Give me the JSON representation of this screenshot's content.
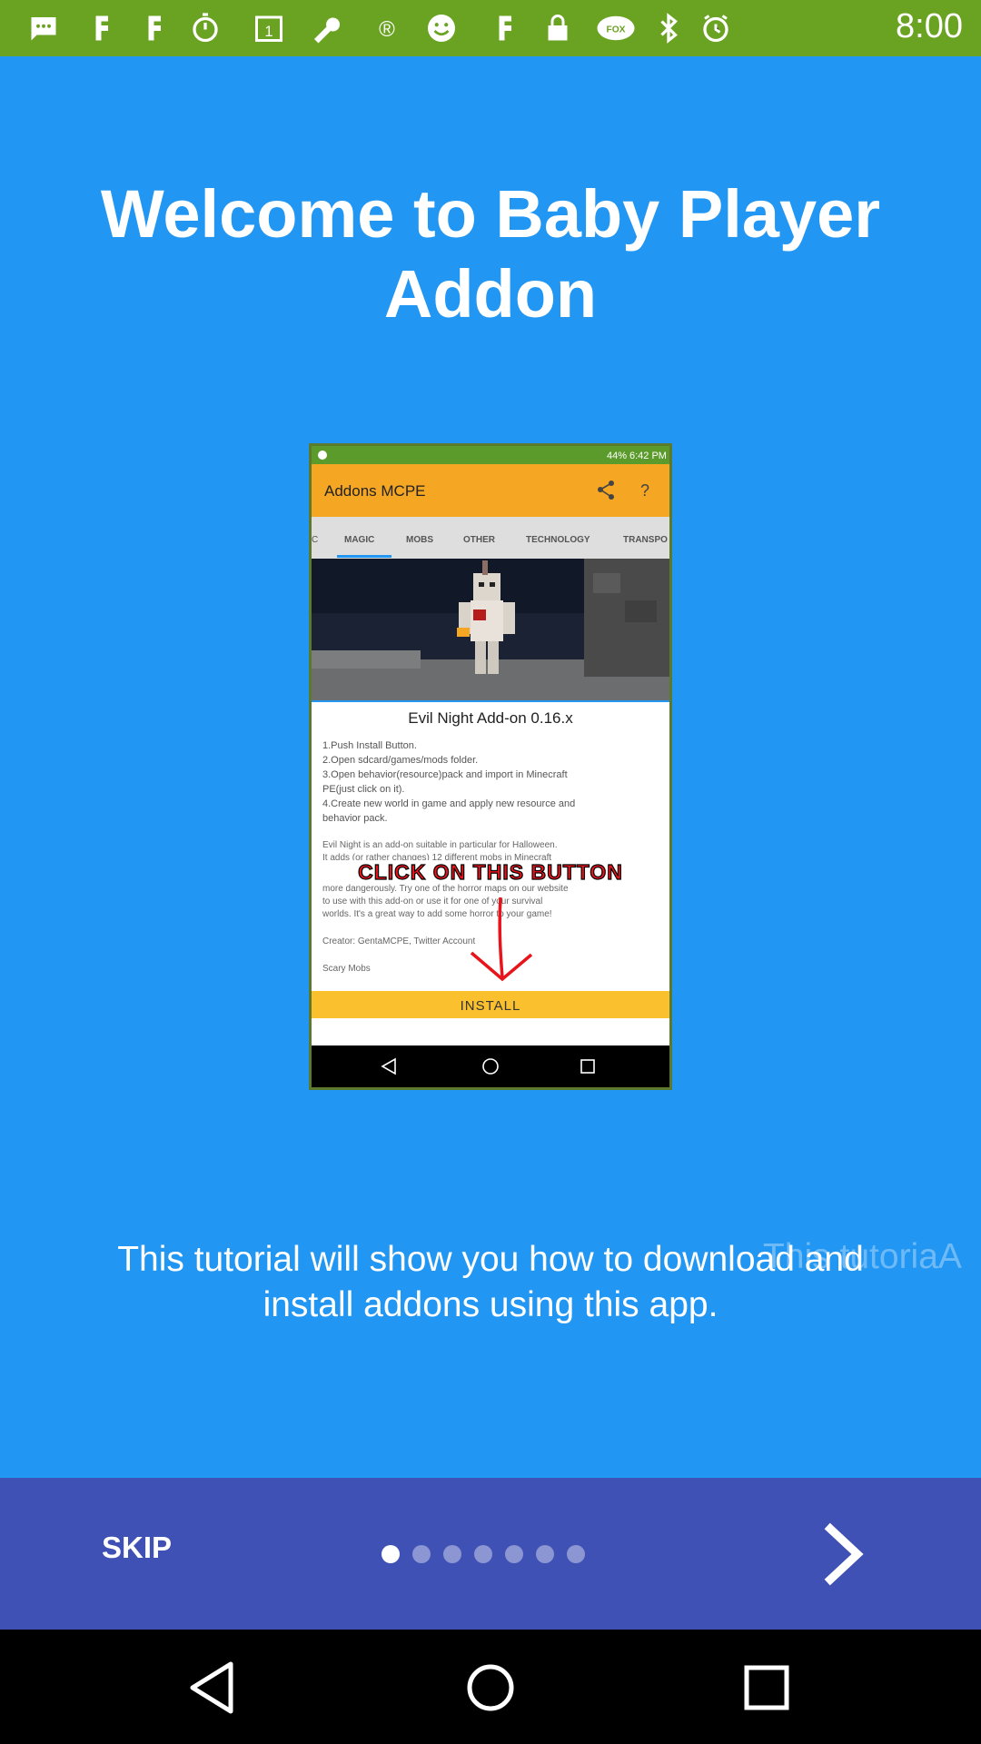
{
  "status_bar": {
    "time": "8:00",
    "icons": [
      "message-icon",
      "facebook-icon",
      "facebook-icon",
      "timer-icon",
      "calendar-icon",
      "wrench-icon",
      "app-icon",
      "smiley-icon",
      "facebook-icon",
      "lock-icon",
      "fox-icon",
      "bluetooth-icon",
      "alarm-icon"
    ]
  },
  "welcome": {
    "title": "Welcome to Baby Player Addon",
    "caption": "This tutorial will show you how to download and install addons using this app.",
    "ghost_text": "This tutoriaA"
  },
  "preview": {
    "status_percent": "44%",
    "status_time": "6:42 PM",
    "toolbar_title": "Addons MCPE",
    "tabs": [
      "C",
      "MAGIC",
      "MOBS",
      "OTHER",
      "TECHNOLOGY",
      "TRANSPO"
    ],
    "active_tab": "MAGIC",
    "addon_title": "Evil Night Add-on 0.16.x",
    "steps": [
      "1.Push Install Button.",
      "2.Open sdcard/games/mods folder.",
      "3.Open behavior(resource)pack and import in Minecraft",
      "PE(just click on it).",
      "4.Create new world in game and apply new resource and",
      "behavior pack."
    ],
    "description": [
      "Evil Night is an add-on suitable in particular for Halloween.",
      "It adds (or rather changes) 12 different mobs in Minecraft",
      "more dangerously. Try one of the horror maps on our website",
      "to use with this add-on or use it for one of your survival",
      "worlds. It's a great way to add some horror to your game!",
      "Creator: GentaMCPE, Twitter Account",
      "Scary Mobs"
    ],
    "callout": "CLICK ON THIS BUTTON",
    "install_label": "INSTALL"
  },
  "bottom_bar": {
    "skip_label": "SKIP",
    "page_count": 7,
    "current_page": 1
  },
  "colors": {
    "background": "#2196f3",
    "status_bar": "#6aa221",
    "bottom_bar": "#3f51b5",
    "preview_toolbar": "#f5a623",
    "install_button": "#fbc02d",
    "callout_red": "#e8141b"
  }
}
